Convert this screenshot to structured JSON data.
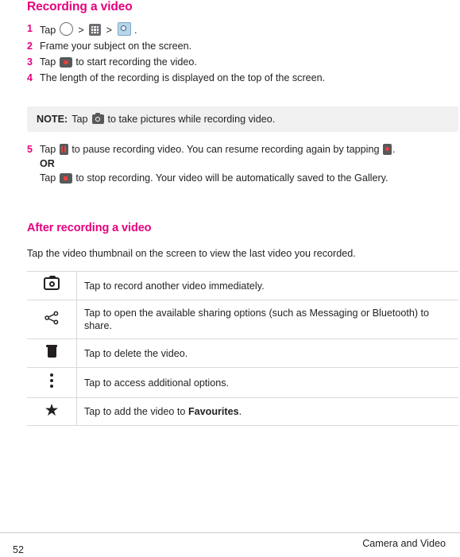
{
  "page": {
    "heading1": "Recording a video",
    "heading2": "After recording a video",
    "number": "52",
    "footer_title": "Camera and Video"
  },
  "steps": [
    {
      "num": "1",
      "prefix": "Tap",
      "sep1": ">",
      "sep2": ">",
      "suffix": ".",
      "icons": [
        "circle-outline-icon",
        "app-grid-icon",
        "camera-switch-icon"
      ]
    },
    {
      "num": "2",
      "text": "Frame your subject on the screen."
    },
    {
      "num": "3",
      "prefix": "Tap",
      "text": "to start recording the video.",
      "icons": [
        "record-button-icon"
      ]
    },
    {
      "num": "4",
      "text": "The length of the recording is displayed on the top of the screen."
    }
  ],
  "note": {
    "label": "NOTE:",
    "prefix": "Tap",
    "text": "to take pictures while recording video.",
    "icon": "camera-icon"
  },
  "step5": {
    "num": "5",
    "line1_prefix": "Tap",
    "line1_mid": "to pause recording video. You can resume recording again by tapping",
    "line1_suffix": ".",
    "or": "OR",
    "line2_prefix": "Tap",
    "line2_text": "to stop recording. Your video will be automatically saved to the Gallery.",
    "icons": [
      "pause-button-icon",
      "resume-button-icon",
      "stop-button-icon"
    ]
  },
  "intro": "Tap the video thumbnail on the screen to view the last video you recorded.",
  "icon_table": {
    "rows": [
      {
        "icon": "camera-icon",
        "desc": "Tap to record another video immediately.",
        "bold": "",
        "tail": ""
      },
      {
        "icon": "share-icon",
        "desc": "Tap to open the available sharing options (such as Messaging or Bluetooth) to share.",
        "bold": "",
        "tail": ""
      },
      {
        "icon": "trash-icon",
        "desc": "Tap to delete the video.",
        "bold": "",
        "tail": ""
      },
      {
        "icon": "more-options-icon",
        "desc": "Tap to access additional options.",
        "bold": "",
        "tail": ""
      },
      {
        "icon": "star-icon",
        "desc": "Tap to add the video to ",
        "bold": "Favourites",
        "tail": "."
      }
    ]
  }
}
